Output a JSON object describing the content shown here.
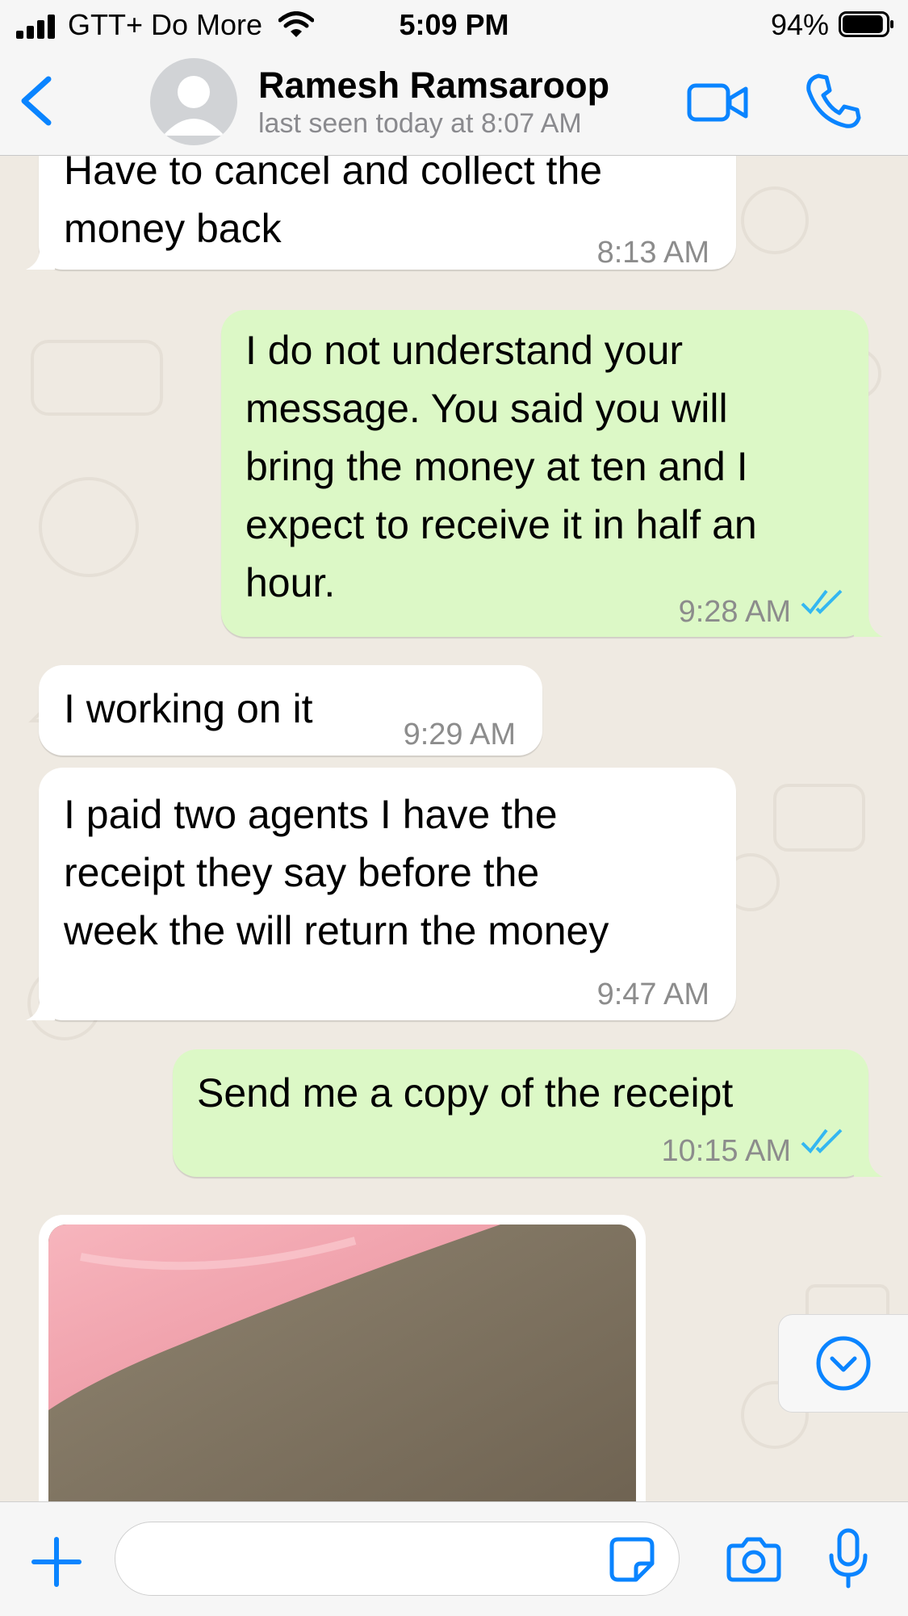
{
  "status_bar": {
    "carrier": "GTT+ Do More",
    "time": "5:09 PM",
    "battery_percent": "94%",
    "battery_level": 0.94
  },
  "header": {
    "contact_name": "Ramesh Ramsaroop",
    "last_seen": "last seen today at 8:07 AM",
    "icons": [
      "chevron-left-icon",
      "avatar",
      "video-camera-icon",
      "phone-icon"
    ]
  },
  "messages": [
    {
      "direction": "incoming",
      "lines": [
        "Have to cancel and collect the",
        "money back"
      ],
      "time": "8:13 AM"
    },
    {
      "direction": "outgoing",
      "lines": [
        "I do not understand your",
        "message. You said you will",
        "bring the money at ten and I",
        "expect to receive it in half an",
        "hour."
      ],
      "time": "9:28 AM",
      "read": true
    },
    {
      "direction": "incoming",
      "lines": [
        "I working on it"
      ],
      "time": "9:29 AM"
    },
    {
      "direction": "incoming",
      "lines": [
        "I paid two agents I have the",
        "receipt they say before the",
        "week the will return the money"
      ],
      "time": "9:47 AM"
    },
    {
      "direction": "outgoing",
      "lines": [
        "Send me a copy of the receipt"
      ],
      "time": "10:15 AM",
      "read": true
    },
    {
      "direction": "incoming",
      "type": "photo"
    }
  ],
  "composer": {
    "placeholder": "",
    "icons": [
      "plus-icon",
      "sticker-icon",
      "camera-icon",
      "microphone-icon"
    ]
  },
  "colors": {
    "accent": "#0a84ff",
    "outgoing_bubble": "#dcf8c6",
    "incoming_bubble": "#ffffff",
    "chat_background": "#efeae2",
    "read_ticks": "#34b7f1"
  }
}
